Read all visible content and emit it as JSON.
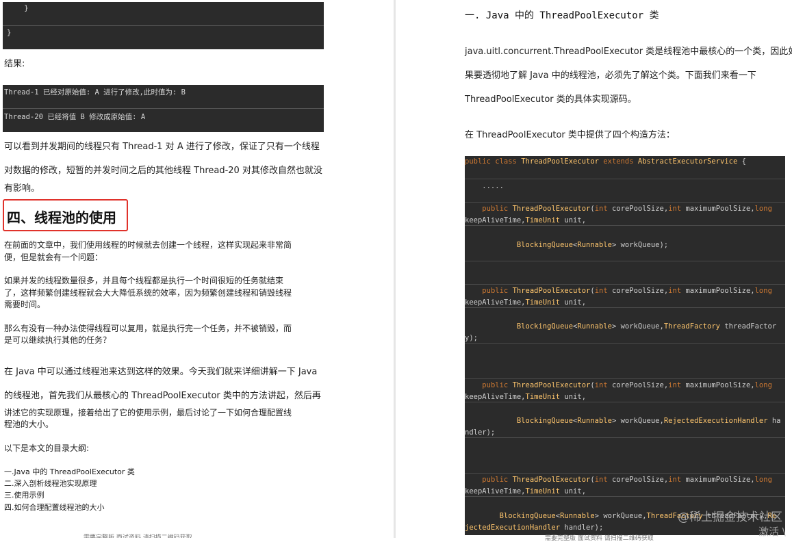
{
  "left": {
    "code_top": [
      "    }",
      "}"
    ],
    "result_label": "结果:",
    "result_lines": [
      "Thread-1 已经对原始值: A 进行了修改,此时值为: B",
      "Thread-20 已经将值 B 修改成原始值: A"
    ],
    "para1_l1": "可以看到并发期间的线程只有 Thread-1 对 A 进行了修改，保证了只有一个线程",
    "para1_l2": "对数据的修改，短暂的并发时间之后的其他线程 Thread-20 对其修改自然也就没",
    "para1_l3": "有影响。",
    "heading": "四、线程池的使用",
    "para2_l1": "在前面的文章中，我们使用线程的时候就去创建一个线程，这样实现起来非常简",
    "para2_l2": "便，但是就会有一个问题：",
    "para3_l1": "如果并发的线程数量很多，并且每个线程都是执行一个时间很短的任务就结束",
    "para3_l2": "了，这样频繁创建线程就会大大降低系统的效率，因为频繁创建线程和销毁线程",
    "para3_l3": "需要时间。",
    "para4_l1": "那么有没有一种办法使得线程可以复用，就是执行完一个任务，并不被销毁，而",
    "para4_l2": "是可以继续执行其他的任务？",
    "para5_l1": "在 Java 中可以通过线程池来达到这样的效果。今天我们就来详细讲解一下 Java",
    "para5_l2": "的线程池，首先我们从最核心的 ThreadPoolExecutor 类中的方法讲起，然后再",
    "para5_l3": "讲述它的实现原理，接着给出了它的使用示例，最后讨论了一下如何合理配置线",
    "para5_l4": "程池的大小。",
    "outline_intro": "以下是本文的目录大纲:",
    "outline": [
      "一.Java 中的 ThreadPoolExecutor 类",
      "二.深入剖析线程池实现原理",
      "三.使用示例",
      "四.如何合理配置线程池的大小"
    ],
    "footer": "需要完整版 面试资料 请扫描二维码获取"
  },
  "right": {
    "section_title": "一. Java 中的 ThreadPoolExecutor 类",
    "p1_l1": "java.uitl.concurrent.ThreadPoolExecutor 类是线程池中最核心的一个类，因此如",
    "p1_l2": "果要透彻地了解 Java 中的线程池，必须先了解这个类。下面我们来看一下",
    "p1_l3": "ThreadPoolExecutor 类的具体实现源码。",
    "p2": "在 ThreadPoolExecutor 类中提供了四个构造方法：",
    "code": {
      "l01_kw": "public class ",
      "l01_ty": "ThreadPoolExecutor",
      "l01_kw2": " extends ",
      "l01_ty2": "AbstractExecutorService",
      "l01_pl": " {",
      "l02": "    .....",
      "ctor_kw": "public ",
      "ctor_name": "ThreadPoolExecutor",
      "ctor_args": "(",
      "int_kw": "int",
      "core": " corePoolSize,",
      "max": " maximumPoolSize,",
      "long_kw": "long",
      "keepalive": "keepAliveTime,",
      "timeunit": "TimeUnit",
      "unit": " unit,",
      "bq": "BlockingQueue",
      "lt": "<",
      "runnable": "Runnable",
      "gt_wq": "> workQueue);",
      "gt_wq2": "> workQueue,",
      "tf": "ThreadFactory",
      "tf_arg": " threadFactor",
      "tf_end": "y);",
      "reh": "RejectedExecutionHandler",
      "reh_arg": " ha",
      "reh_end": "ndler);",
      "tf2": "ThreadFactory",
      "tf2_arg": " threadFactory,",
      "re": "Re",
      "reh2": "jectedExecutionHandler",
      "reh2_end": " handler);"
    },
    "watermark": "@稀土掘金技术社区",
    "watermark2": "激活 \\",
    "footer": "需要完整版 面试资料 请扫描二维码获取"
  }
}
